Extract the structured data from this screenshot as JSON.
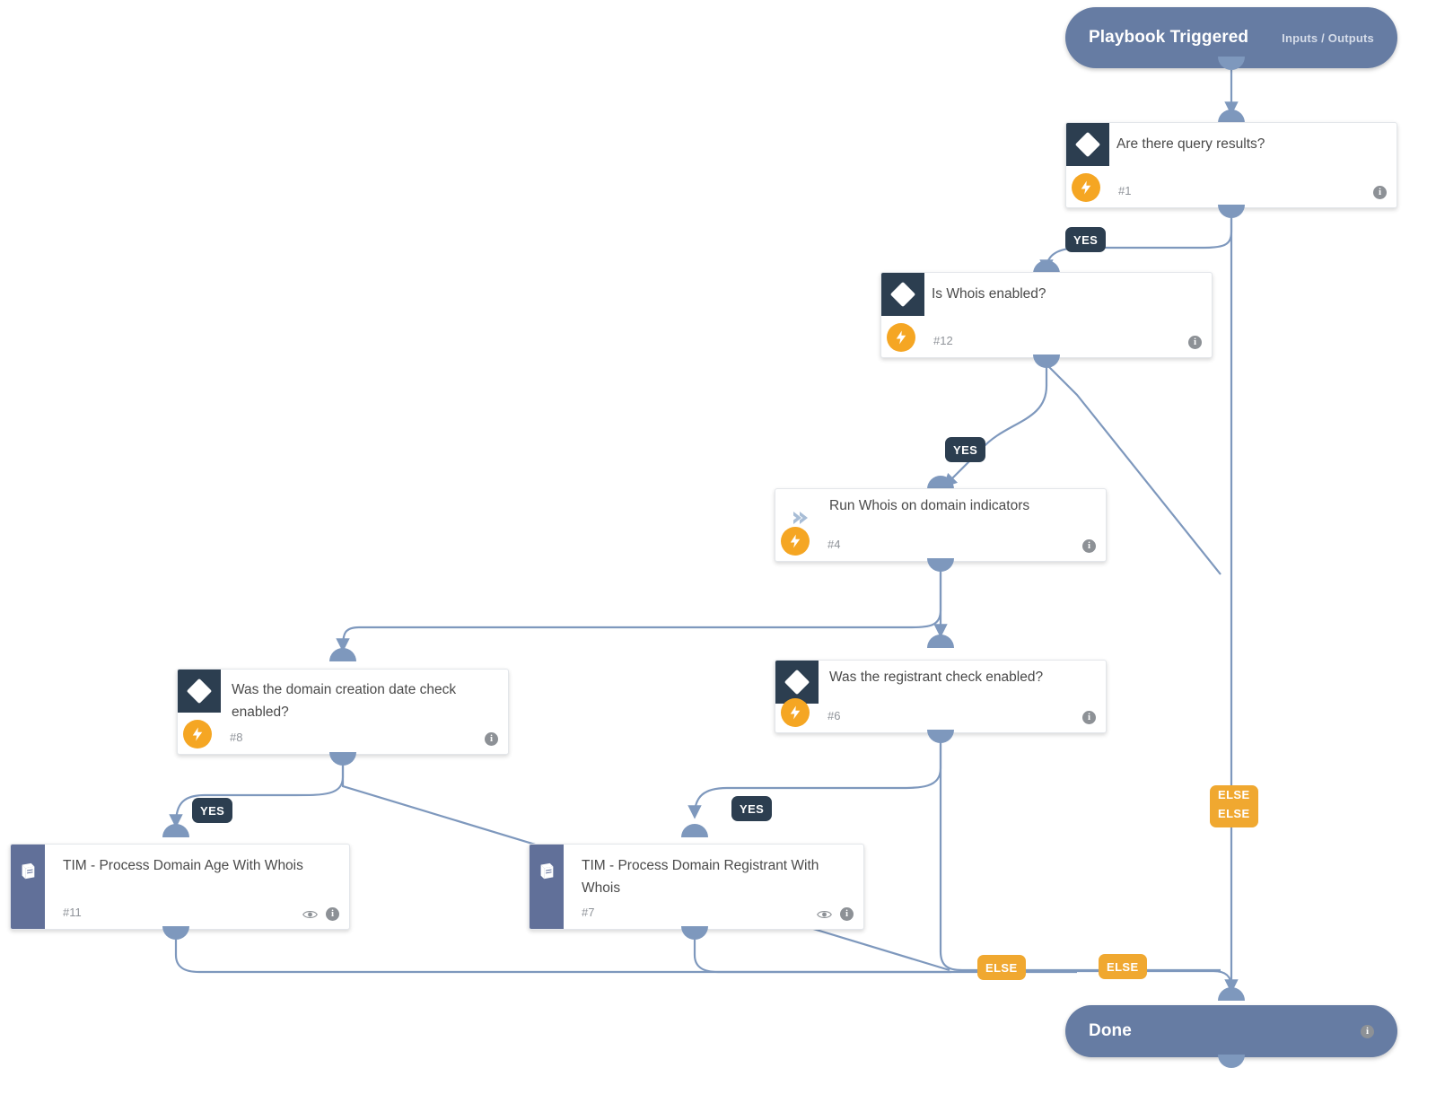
{
  "playbook": {
    "start": {
      "title": "Playbook Triggered",
      "right_label": "Inputs / Outputs"
    },
    "end": {
      "title": "Done",
      "info_glyph": "i"
    },
    "tasks": [
      {
        "id": "1",
        "title": "Are there query results?",
        "number": "#1",
        "type": "condition",
        "icon": "diamond-icon",
        "automation_icon": "bolt-icon",
        "info_glyph": "i"
      },
      {
        "id": "12",
        "title": "Is Whois enabled?",
        "number": "#12",
        "type": "condition",
        "icon": "diamond-icon",
        "automation_icon": "bolt-icon",
        "info_glyph": "i"
      },
      {
        "id": "4",
        "title": "Run Whois on domain indicators",
        "number": "#4",
        "type": "regular",
        "icon": "chevron-right-icon",
        "automation_icon": "bolt-icon",
        "info_glyph": "i"
      },
      {
        "id": "8",
        "title": "Was the domain creation date check enabled?",
        "number": "#8",
        "type": "condition",
        "icon": "diamond-icon",
        "automation_icon": "bolt-icon",
        "info_glyph": "i"
      },
      {
        "id": "6",
        "title": "Was the registrant check enabled?",
        "number": "#6",
        "type": "condition",
        "icon": "diamond-icon",
        "automation_icon": "bolt-icon",
        "info_glyph": "i"
      },
      {
        "id": "11",
        "title": "TIM - Process Domain Age With Whois",
        "number": "#11",
        "type": "sub-playbook",
        "icon": "book-icon",
        "eye_icon": "eye-icon",
        "info_glyph": "i"
      },
      {
        "id": "7",
        "title": "TIM - Process Domain Registrant With Whois",
        "number": "#7",
        "type": "sub-playbook",
        "icon": "book-icon",
        "eye_icon": "eye-icon",
        "info_glyph": "i"
      }
    ],
    "branch_labels": {
      "yes_1": "YES",
      "yes_12": "YES",
      "yes_8": "YES",
      "yes_6": "YES",
      "else_1_a": "ELSE",
      "else_1_b": "ELSE",
      "else_8": "ELSE",
      "else_6": "ELSE"
    },
    "colors": {
      "terminal": "#667ca3",
      "condition_chip": "#2c3e50",
      "sub_playbook_stripe": "#617099",
      "automation_badge": "#f5a623",
      "else_badge": "#f0a830",
      "yes_badge": "#2c3e50",
      "edge": "#7e98bd",
      "card_background": "#ffffff",
      "canvas": "#ffffff"
    }
  }
}
